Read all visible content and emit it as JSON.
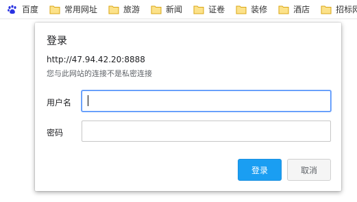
{
  "bookmarks": [
    {
      "label": "百度",
      "icon": "baidu-paw-icon"
    },
    {
      "label": "常用网址",
      "icon": "folder-icon"
    },
    {
      "label": "旅游",
      "icon": "folder-icon"
    },
    {
      "label": "新闻",
      "icon": "folder-icon"
    },
    {
      "label": "证卷",
      "icon": "folder-icon"
    },
    {
      "label": "装修",
      "icon": "folder-icon"
    },
    {
      "label": "酒店",
      "icon": "folder-icon"
    },
    {
      "label": "招标网",
      "icon": "folder-icon"
    }
  ],
  "dialog": {
    "title": "登录",
    "url": "http://47.94.42.20:8888",
    "note": "您与此网站的连接不是私密连接",
    "username_label": "用户名",
    "username_value": "",
    "password_label": "密码",
    "password_value": "",
    "ok_label": "登录",
    "cancel_label": "取消"
  },
  "colors": {
    "folder": "#f7c948",
    "baidu": "#2932e1",
    "primary_button": "#1a9ef2",
    "focus_border": "#4d90fe"
  }
}
